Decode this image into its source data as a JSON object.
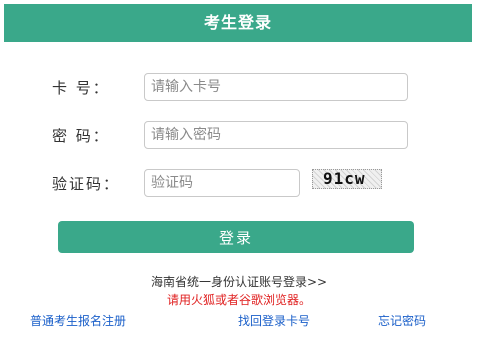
{
  "header": {
    "title": "考生登录"
  },
  "form": {
    "card": {
      "label": "卡  号：",
      "placeholder": "请输入卡号",
      "value": ""
    },
    "password": {
      "label": "密  码：",
      "placeholder": "请输入密码",
      "value": ""
    },
    "captcha": {
      "label": "验证码：",
      "placeholder": "验证码",
      "value": "",
      "image_text": "91cw"
    },
    "login_button": "登录"
  },
  "notes": {
    "hainan_link": "海南省统一身份认证账号登录>>",
    "browser_warning": "请用火狐或者谷歌浏览器。"
  },
  "footer_links": {
    "register": "普通考生报名注册",
    "recover_card": "找回登录卡号",
    "forgot_password": "忘记密码"
  },
  "colors": {
    "accent": "#3aa88a",
    "warning": "#e02020",
    "link": "#1a5fc9"
  }
}
